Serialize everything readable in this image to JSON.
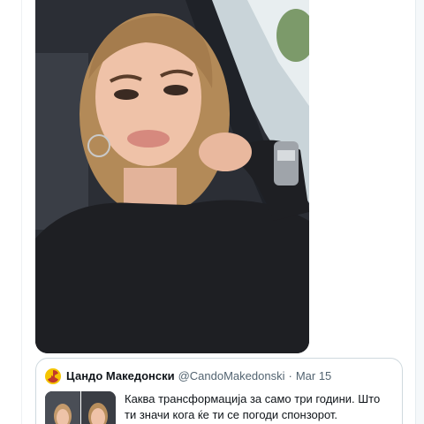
{
  "quoted_tweet": {
    "display_name": "Цандо Македонски",
    "handle": "@CandoMakedonski",
    "separator": "·",
    "date": "Mar 15",
    "text": "Каква трансформација за само три години. Што ти значи кога ќе ти се погоди спонзорот.",
    "avatar_icon": "radiation-icon"
  },
  "colors": {
    "card_border": "#cfd9de",
    "secondary_text": "#536471",
    "primary_text": "#0f1419",
    "avatar_yellow": "#f5c400"
  }
}
